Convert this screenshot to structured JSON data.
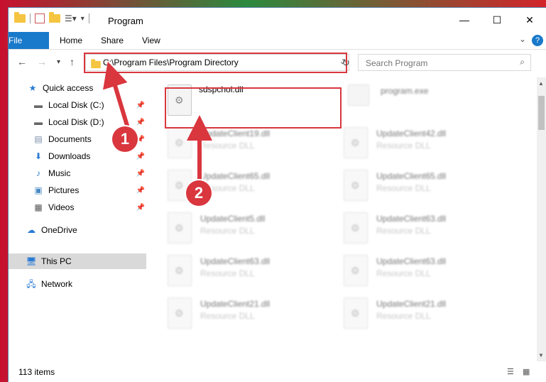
{
  "window": {
    "title": "Program",
    "minimize": "—",
    "maximize": "☐",
    "close": "✕"
  },
  "ribbon": {
    "tabs": [
      "File",
      "Home",
      "Share",
      "View"
    ],
    "help": "?"
  },
  "address": {
    "path": "C:\\Program Files\\Program Directory",
    "search_placeholder": "Search Program"
  },
  "navpane": {
    "items": [
      {
        "label": "Quick access",
        "icon": "star-icon"
      },
      {
        "label": "Local Disk (C:)",
        "icon": "disk-icon"
      },
      {
        "label": "Local Disk (D:)",
        "icon": "disk-icon"
      },
      {
        "label": "Documents",
        "icon": "documents-icon"
      },
      {
        "label": "Downloads",
        "icon": "download-icon"
      },
      {
        "label": "Music",
        "icon": "music-icon"
      },
      {
        "label": "Pictures",
        "icon": "pictures-icon"
      },
      {
        "label": "Videos",
        "icon": "videos-icon"
      },
      {
        "label": "OneDrive",
        "icon": "cloud-icon"
      },
      {
        "label": "This PC",
        "icon": "computer-icon"
      },
      {
        "label": "Network",
        "icon": "network-icon"
      }
    ]
  },
  "files": {
    "highlighted": {
      "name": "sdspchol.dll"
    },
    "program": {
      "name": "program.exe"
    },
    "blurred": [
      {
        "name": "UpdateClient19.dll",
        "desc": "Resource DLL"
      },
      {
        "name": "UpdateClient42.dll",
        "desc": "Resource DLL"
      },
      {
        "name": "UpdateClient65.dll",
        "desc": "Resource DLL"
      },
      {
        "name": "UpdateClient65.dll",
        "desc": "Resource DLL"
      },
      {
        "name": "UpdateClient5.dll",
        "desc": "Resource DLL"
      },
      {
        "name": "UpdateClient63.dll",
        "desc": "Resource DLL"
      },
      {
        "name": "UpdateClient63.dll",
        "desc": "Resource DLL"
      },
      {
        "name": "UpdateClient63.dll",
        "desc": "Resource DLL"
      },
      {
        "name": "UpdateClient21.dll",
        "desc": "Resource DLL"
      },
      {
        "name": "UpdateClient21.dll",
        "desc": "Resource DLL"
      }
    ]
  },
  "status": {
    "count": "113 items"
  },
  "annotations": {
    "step1": "1",
    "step2": "2",
    "color": "#d9363e"
  },
  "colors": {
    "accent": "#1979ca",
    "highlight": "#d9363e"
  }
}
